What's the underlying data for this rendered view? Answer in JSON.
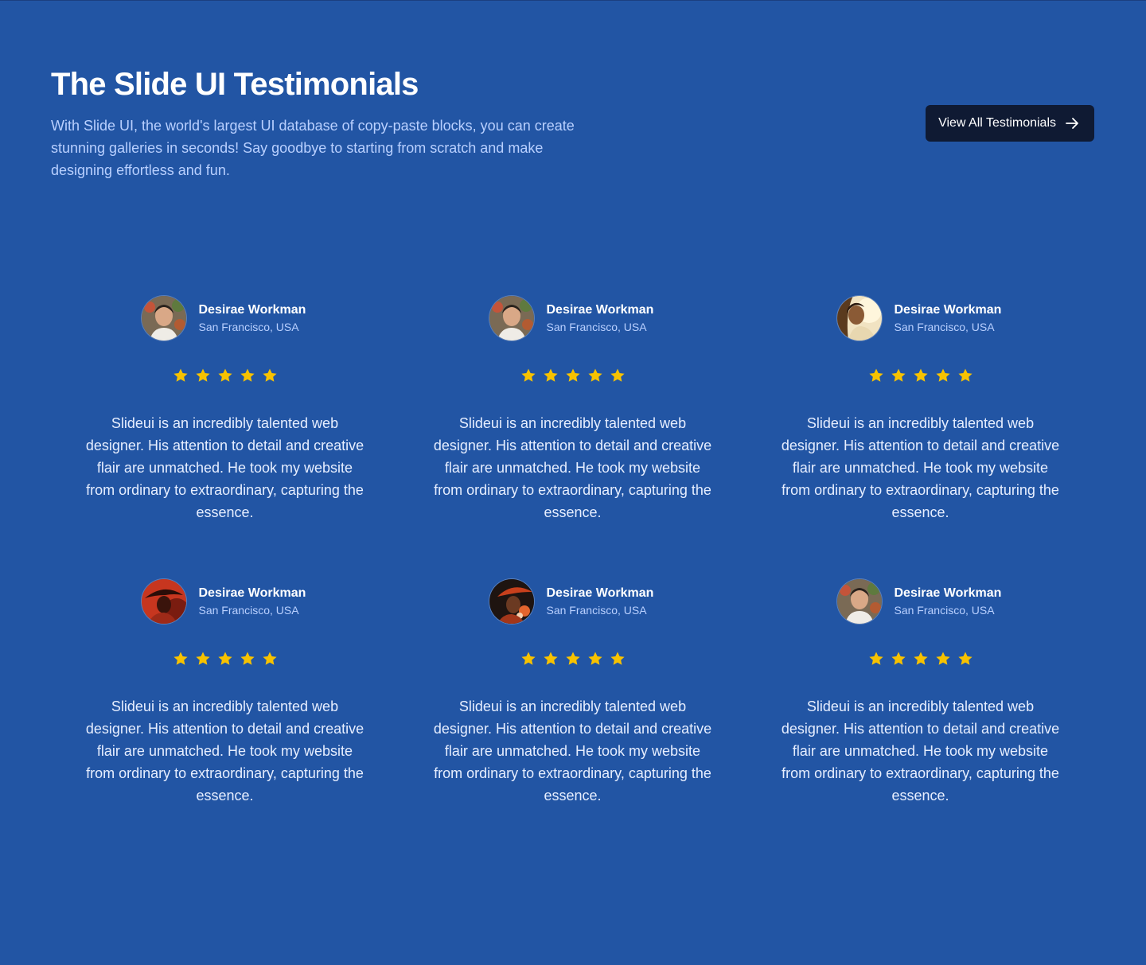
{
  "header": {
    "title": "The Slide UI Testimonials",
    "subtitle": "With Slide UI, the world's largest UI database of copy-paste blocks, you can create stunning galleries in seconds! Say goodbye to starting from scratch and make designing effortless and fun.",
    "cta_label": "View All Testimonials"
  },
  "colors": {
    "background": "#2255a4",
    "button": "#0f1a33",
    "star": "#f7c200",
    "muted_text": "#b9d0ff"
  },
  "testimonials": [
    {
      "name": "Desirae Workman",
      "location": "San Francisco, USA",
      "rating": 5,
      "quote": "Slideui is an incredibly talented web designer. His attention to detail and creative flair are unmatched. He took my website from ordinary to extraordinary, capturing the essence."
    },
    {
      "name": "Desirae Workman",
      "location": "San Francisco, USA",
      "rating": 5,
      "quote": "Slideui is an incredibly talented web designer. His attention to detail and creative flair are unmatched. He took my website from ordinary to extraordinary, capturing the essence."
    },
    {
      "name": "Desirae Workman",
      "location": "San Francisco, USA",
      "rating": 5,
      "quote": "Slideui is an incredibly talented web designer. His attention to detail and creative flair are unmatched. He took my website from ordinary to extraordinary, capturing the essence."
    },
    {
      "name": "Desirae Workman",
      "location": "San Francisco, USA",
      "rating": 5,
      "quote": "Slideui is an incredibly talented web designer. His attention to detail and creative flair are unmatched. He took my website from ordinary to extraordinary, capturing the essence."
    },
    {
      "name": "Desirae Workman",
      "location": "San Francisco, USA",
      "rating": 5,
      "quote": "Slideui is an incredibly talented web designer. His attention to detail and creative flair are unmatched. He took my website from ordinary to extraordinary, capturing the essence."
    },
    {
      "name": "Desirae Workman",
      "location": "San Francisco, USA",
      "rating": 5,
      "quote": "Slideui is an incredibly talented web designer. His attention to detail and creative flair are unmatched. He took my website from ordinary to extraordinary, capturing the essence."
    }
  ]
}
